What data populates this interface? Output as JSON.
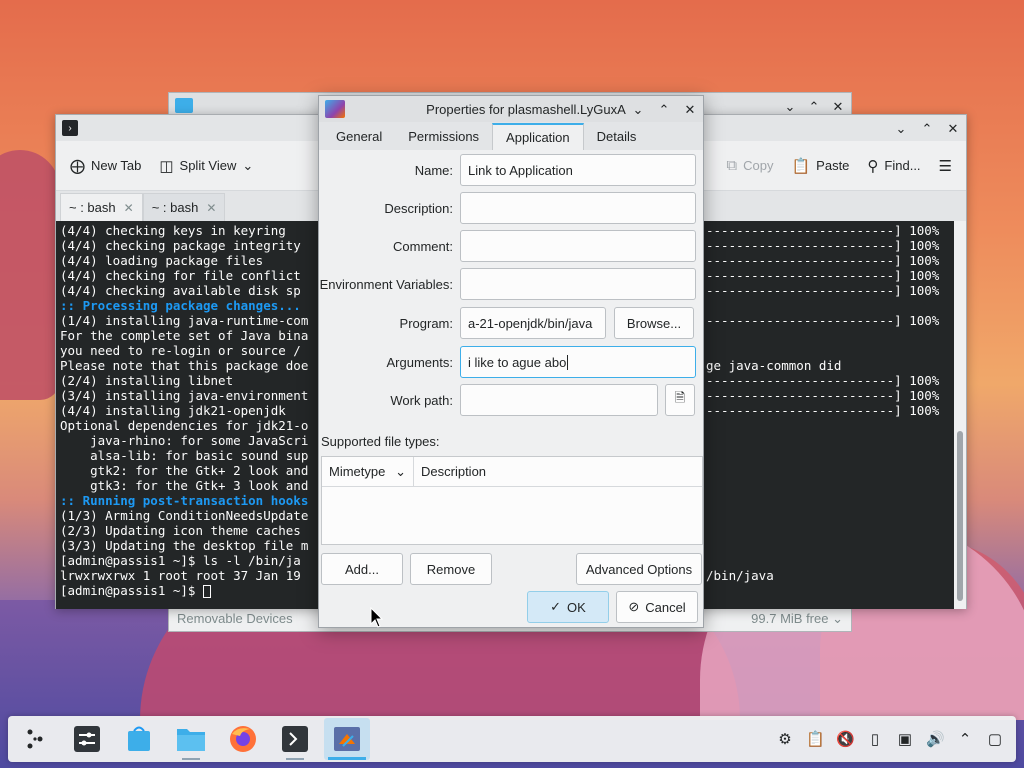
{
  "dolphin": {
    "status_left": "Removable Devices",
    "status_right": "99.7 MiB free"
  },
  "konsole": {
    "toolbar": {
      "new_tab": "New Tab",
      "split_view": "Split View",
      "copy": "Copy",
      "paste": "Paste",
      "find": "Find..."
    },
    "tabs": [
      {
        "label": "~ : bash"
      },
      {
        "label": "~ : bash"
      }
    ],
    "terminal_left": [
      "(4/4) checking keys in keyring",
      "(4/4) checking package integrity",
      "(4/4) loading package files",
      "(4/4) checking for file conflict",
      "(4/4) checking available disk sp",
      ":: Processing package changes...",
      "(1/4) installing java-runtime-com",
      "For the complete set of Java bina",
      "you need to re-login or source /",
      "Please note that this package doe",
      "(2/4) installing libnet",
      "(3/4) installing java-environment",
      "(4/4) installing jdk21-openjdk",
      "Optional dependencies for jdk21-o",
      "    java-rhino: for some JavaScri",
      "    alsa-lib: for basic sound sup",
      "    gtk2: for the Gtk+ 2 look and",
      "    gtk3: for the Gtk+ 3 look and",
      ":: Running post-transaction hooks",
      "(1/3) Arming ConditionNeedsUpdate",
      "(2/3) Updating icon theme caches",
      "(3/3) Updating the desktop file m",
      "[admin@passis1 ~]$ ls -l /bin/ja",
      "lrwxrwxrwx 1 root root 37 Jan 19",
      "[admin@passis1 ~]$ "
    ],
    "terminal_right": [
      "-------------------------] 100%",
      "-------------------------] 100%",
      "-------------------------] 100%",
      "-------------------------] 100%",
      "-------------------------] 100%",
      "",
      "-------------------------] 100%",
      "",
      "",
      "ge java-common did",
      "-------------------------] 100%",
      "-------------------------] 100%",
      "-------------------------] 100%",
      "",
      "",
      "",
      "",
      "",
      "",
      "",
      "",
      "",
      "",
      "/bin/java",
      ""
    ]
  },
  "dialog": {
    "title": "Properties for plasmashell.LyGuxA",
    "tabs": [
      "General",
      "Permissions",
      "Application",
      "Details"
    ],
    "active_tab": "Application",
    "name_label": "Name:",
    "name_value": "Link to Application",
    "description_label": "Description:",
    "description_value": "",
    "comment_label": "Comment:",
    "comment_value": "",
    "env_label": "Environment Variables:",
    "env_value": "",
    "program_label": "Program:",
    "program_value": "a-21-openjdk/bin/java",
    "browse_label": "Browse...",
    "arguments_label": "Arguments:",
    "arguments_value": "i like to ague abo",
    "workpath_label": "Work path:",
    "workpath_value": "",
    "filetypes_label": "Supported file types:",
    "col_mimetype": "Mimetype",
    "col_description": "Description",
    "add_label": "Add...",
    "remove_label": "Remove",
    "advanced_label": "Advanced Options",
    "ok_label": "OK",
    "cancel_label": "Cancel"
  },
  "taskbar": {
    "items": [
      "app-launcher",
      "system-settings",
      "discover",
      "dolphin",
      "firefox",
      "konsole",
      "properties-dialog"
    ],
    "tray": [
      "network-icon",
      "clipboard-icon",
      "volume-muted-icon",
      "usb-icon",
      "display-icon",
      "volume-icon",
      "expand-tray-icon",
      "show-desktop-icon"
    ]
  },
  "colors": {
    "accent": "#3daee9",
    "terminal_bg": "#232627",
    "terminal_highlight": "#1d99f3"
  }
}
